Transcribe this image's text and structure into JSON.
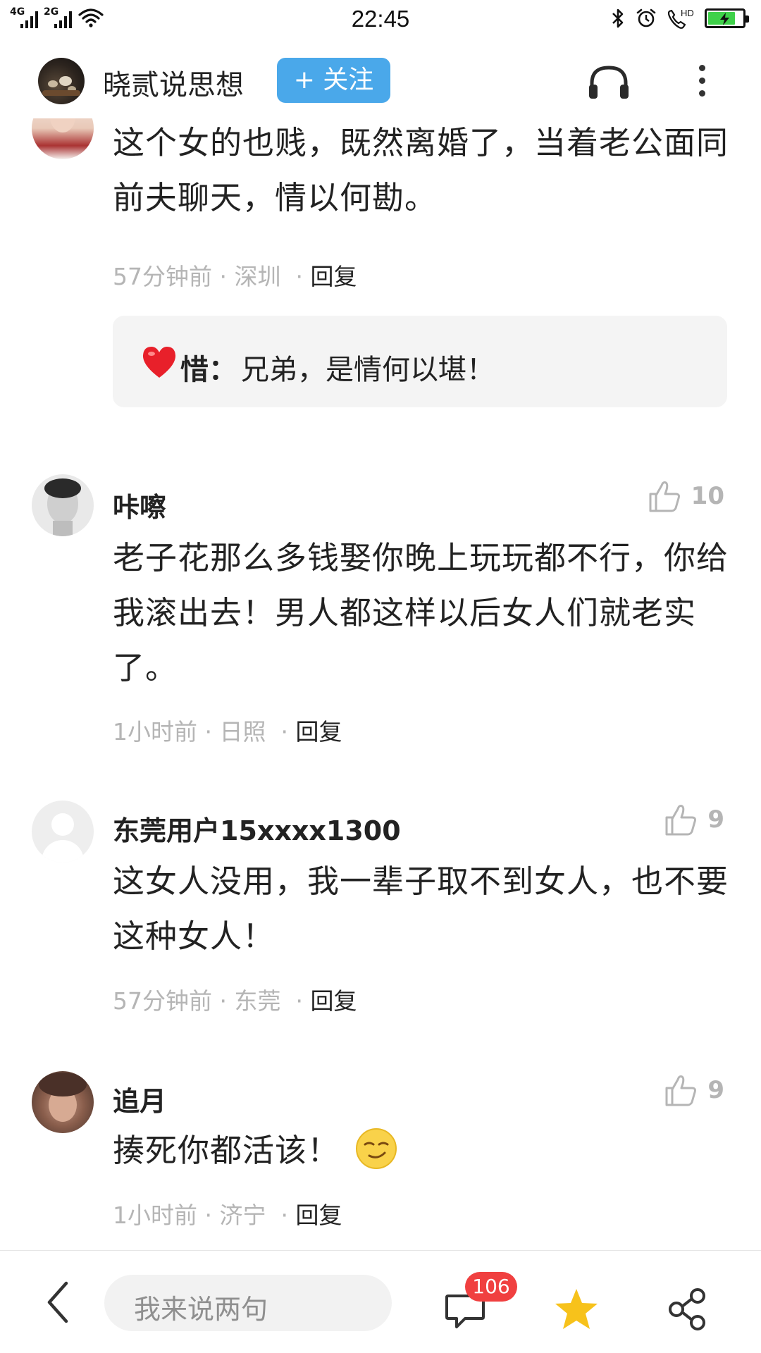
{
  "status_bar": {
    "time": "22:45",
    "network1": "4G",
    "network2": "2G",
    "hd": "HD",
    "battery_fraction": 0.8,
    "battery_color": "#3fd14a"
  },
  "header": {
    "account_name": "晓贰说思想",
    "follow_label": "+ 关注",
    "follow_color": "#4aa8ea",
    "icons": [
      "headphones-icon",
      "more-icon"
    ]
  },
  "comments": [
    {
      "name": "",
      "text": "这个女的也贱，既然离婚了，当着老公面同前夫聊天，情以何勘。",
      "time": "57分钟前",
      "location": "深圳",
      "reply_label": "回复",
      "reply": {
        "name": "惜：",
        "text": "兄弟，是情何以堪！"
      }
    },
    {
      "name": "咔嚓",
      "likes": "10",
      "text": "老子花那么多钱娶你晚上玩玩都不行，你给我滚出去！男人都这样以后女人们就老实了。",
      "time": "1小时前",
      "location": "日照",
      "reply_label": "回复"
    },
    {
      "name": "东莞用户15xxxx1300",
      "likes": "9",
      "text": "这女人没用，我一辈子取不到女人，也不要这种女人！",
      "time": "57分钟前",
      "location": "东莞",
      "reply_label": "回复"
    },
    {
      "name": "追月",
      "likes": "9",
      "text": "揍死你都活该！",
      "time": "1小时前",
      "location": "济宁",
      "reply_label": "回复"
    }
  ],
  "bottom_bar": {
    "input_placeholder": "我来说两句",
    "comment_count": "106",
    "badge_color": "#f04040",
    "star_color": "#f7c21b",
    "icons": [
      "back-icon",
      "comment-icon",
      "star-icon",
      "share-icon"
    ]
  }
}
